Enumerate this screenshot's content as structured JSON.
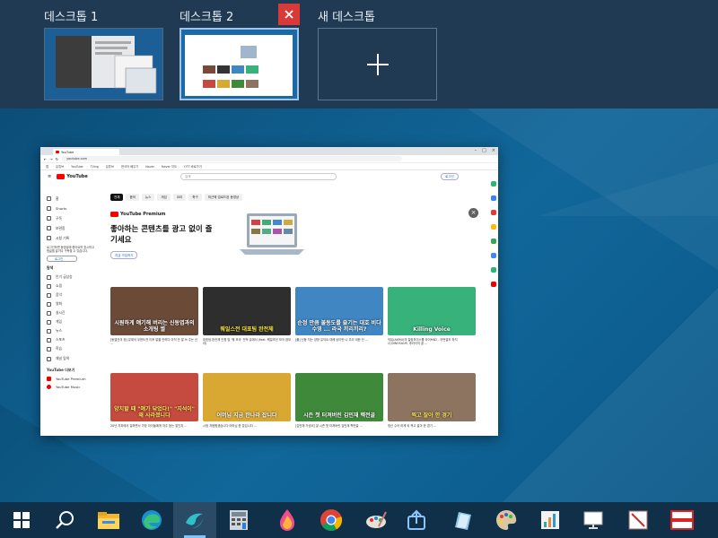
{
  "desktops": [
    {
      "label": "데스크톱 1"
    },
    {
      "label": "데스크톱 2"
    }
  ],
  "new_desktop": {
    "label": "새 데스크톱",
    "icon": "plus-icon"
  },
  "close_icon": "close-icon",
  "window": {
    "tab_title": "YouTube",
    "url": "youtube.com",
    "bookmarks": [
      "앱",
      "유튜브",
      "YouTube",
      "TVing",
      "유튜브",
      "한국어 배우기",
      "Naver",
      "Naver 지도",
      "OTT 바로가기"
    ],
    "search_placeholder": "검색",
    "login": "로그인",
    "chips": [
      "전체",
      "음악",
      "뉴스",
      "게임",
      "요리",
      "축구",
      "최근에 업로드된 동영상"
    ],
    "sidebar_main": [
      "홈",
      "Shorts",
      "구독"
    ],
    "sidebar_lib": [
      "보관함",
      "시청 기록"
    ],
    "sidebar_note": "로그인하면 동영상에 좋아요를 표시하고 댓글을 달거나 구독할 수 있습니다.",
    "sidebar_login": "로그인",
    "explore_title": "탐색",
    "sidebar_explore": [
      "인기 급상승",
      "쇼핑",
      "음악",
      "영화",
      "실시간",
      "게임",
      "뉴스",
      "스포츠",
      "학습"
    ],
    "sidebar_channel": "채널 탐색",
    "more_title": "YouTube 더보기",
    "sidebar_more": [
      "YouTube Premium",
      "YouTube Music"
    ],
    "promo": {
      "brand": "YouTube Premium",
      "title": "좋아하는 콘텐츠를 광고 없이 즐기세요",
      "button": "지금 가입하기"
    },
    "videos": [
      {
        "caption": "시원하게 얘기해 버리는 신동엽과의 소개팅 썰",
        "meta": "[동엽신의 정] 유재석 무한도전 이후 말을 안하다 아직 안 말 쓰 주는 신 ...",
        "bg": "#6b4a38"
      },
      {
        "caption": "웨일스전 대표팀 완전체",
        "meta": "대표팀 완전체 인원 및 '웨 모국' 전적 유에서 (feat. 웨일즈전 모국 참모라)",
        "bg": "#2e2e2e"
      },
      {
        "caption": "순정 만큼 불동도를 즐기는 대호 비다 수영 ... 라국 끼리끼리?",
        "meta": "[풀] 신동 지는 양방 유익요 대에 남이만 나 우리 대한 단 ...",
        "bg": "#3f86c2"
      },
      {
        "caption": "Killing Voice",
        "meta": "악뮤(AKMU)의 킬링보이스를 라이브로! - 어떤말도 하지 너,DINOSAUR, 후라이의 꿈 ...",
        "bg": "#36b27a"
      },
      {
        "caption": "양치할 때 \"얘가 닦었다!\" \"지석이\" 왜 사라졌니다",
        "meta": "20년 치과에서 일하면서 가장 아이들에게 자주 듣는 말인지 ...",
        "bg": "#c54a3f"
      },
      {
        "caption": "어머님 지금 한나라 잡니다",
        "meta": "시청 처음뵙겠습니다 어머님 한 분입니다 ...",
        "bg": "#d8a832"
      },
      {
        "caption": "시즌 첫 터져버린 김민재 헥전골",
        "meta": "[김민재 가성비] 잘 시즌 첫 터져버린 김민재 헥전골 ...",
        "bg": "#3f8a3a"
      },
      {
        "caption": "찍고 잘아 한 경기",
        "meta": "정신 수어 하게 되 찍고 잘아 한 경기 ...",
        "bg": "#8c7460"
      }
    ]
  },
  "taskbar": [
    {
      "name": "start-icon"
    },
    {
      "name": "search-icon"
    },
    {
      "name": "file-explorer-icon"
    },
    {
      "name": "edge-icon"
    },
    {
      "name": "app-swirl-icon"
    },
    {
      "name": "calculator-icon"
    },
    {
      "name": "paint-drop-icon"
    },
    {
      "name": "chrome-icon"
    },
    {
      "name": "brush-app-icon"
    },
    {
      "name": "upload-tool-icon"
    },
    {
      "name": "notes-app-icon"
    },
    {
      "name": "palette-icon"
    },
    {
      "name": "chart-app-icon"
    },
    {
      "name": "monitor-app-icon"
    },
    {
      "name": "pen-app-icon"
    },
    {
      "name": "red-window-icon"
    }
  ]
}
